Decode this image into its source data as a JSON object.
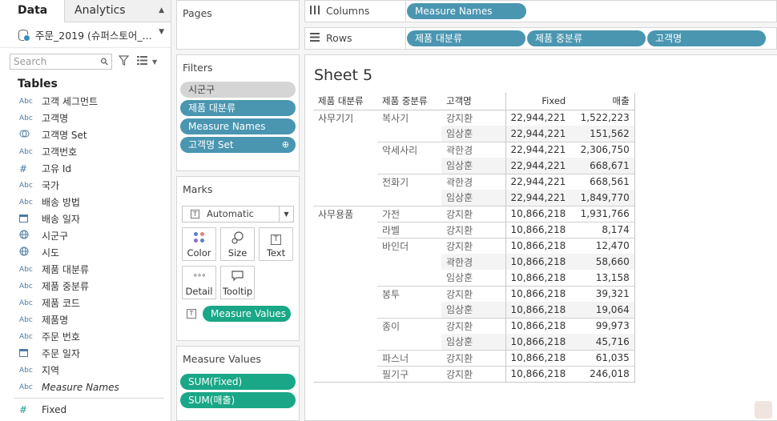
{
  "tabs": {
    "data": "Data",
    "analytics": "Analytics"
  },
  "datasource": "주문_2019 (슈퍼스토어_...",
  "search": {
    "placeholder": "Search"
  },
  "tables_label": "Tables",
  "fields": [
    {
      "type": "Abc",
      "name": "고객 세그먼트"
    },
    {
      "type": "Abc",
      "name": "고객명"
    },
    {
      "type": "set",
      "name": "고객명 Set"
    },
    {
      "type": "Abc",
      "name": "고객번호"
    },
    {
      "type": "#",
      "name": "고유 Id"
    },
    {
      "type": "Abc",
      "name": "국가"
    },
    {
      "type": "Abc",
      "name": "배송 방법"
    },
    {
      "type": "date",
      "name": "배송 일자"
    },
    {
      "type": "geo",
      "name": "시군구"
    },
    {
      "type": "geo",
      "name": "시도"
    },
    {
      "type": "Abc",
      "name": "제품 대분류"
    },
    {
      "type": "Abc",
      "name": "제품 중분류"
    },
    {
      "type": "Abc",
      "name": "제품 코드"
    },
    {
      "type": "Abc",
      "name": "제품명"
    },
    {
      "type": "Abc",
      "name": "주문 번호"
    },
    {
      "type": "date",
      "name": "주문 일자"
    },
    {
      "type": "Abc",
      "name": "지역"
    },
    {
      "type": "Abc",
      "name": "Measure Names"
    }
  ],
  "measures": [
    {
      "type": "#",
      "name": "Fixed"
    },
    {
      "type": "#",
      "name": "매출"
    }
  ],
  "pages_title": "Pages",
  "filters_title": "Filters",
  "filters": [
    "시군구",
    "제품 대분류",
    "Measure Names",
    "고객명 Set"
  ],
  "marks_title": "Marks",
  "mark_type": "Automatic",
  "mark_buttons": {
    "color": "Color",
    "size": "Size",
    "text": "Text",
    "detail": "Detail",
    "tooltip": "Tooltip"
  },
  "marks_pill": "Measure Values",
  "mv_title": "Measure Values",
  "mv_pills": [
    "SUM(Fixed)",
    "SUM(매출)"
  ],
  "columns_label": "Columns",
  "columns_pills": [
    "Measure Names"
  ],
  "rows_label": "Rows",
  "rows_pills": [
    "제품 대분류",
    "제품 중분류",
    "고객명"
  ],
  "sheet_title": "Sheet 5",
  "headers": [
    "제품 대분류",
    "제품 중분류",
    "고객명",
    "Fixed",
    "매출"
  ],
  "rows": [
    [
      "사무기기",
      "복사기",
      "강지환",
      "22,944,221",
      "1,522,223"
    ],
    [
      "",
      "",
      "임상훈",
      "22,944,221",
      "151,562"
    ],
    [
      "",
      "악세사리",
      "곽한경",
      "22,944,221",
      "2,306,750"
    ],
    [
      "",
      "",
      "임상훈",
      "22,944,221",
      "668,671"
    ],
    [
      "",
      "전화기",
      "곽한경",
      "22,944,221",
      "668,561"
    ],
    [
      "",
      "",
      "임상훈",
      "22,944,221",
      "1,849,770"
    ],
    [
      "사무용품",
      "가전",
      "강지환",
      "10,866,218",
      "1,931,766"
    ],
    [
      "",
      "라벨",
      "강지환",
      "10,866,218",
      "8,174"
    ],
    [
      "",
      "바인더",
      "강지환",
      "10,866,218",
      "12,470"
    ],
    [
      "",
      "",
      "곽한경",
      "10,866,218",
      "58,660"
    ],
    [
      "",
      "",
      "임상훈",
      "10,866,218",
      "13,158"
    ],
    [
      "",
      "봉투",
      "강지환",
      "10,866,218",
      "39,321"
    ],
    [
      "",
      "",
      "임상훈",
      "10,866,218",
      "19,064"
    ],
    [
      "",
      "종이",
      "강지환",
      "10,866,218",
      "99,973"
    ],
    [
      "",
      "",
      "임상훈",
      "10,866,218",
      "45,716"
    ],
    [
      "",
      "파스너",
      "강지환",
      "10,866,218",
      "61,035"
    ],
    [
      "",
      "필기구",
      "강지환",
      "10,866,218",
      "246,018"
    ]
  ]
}
